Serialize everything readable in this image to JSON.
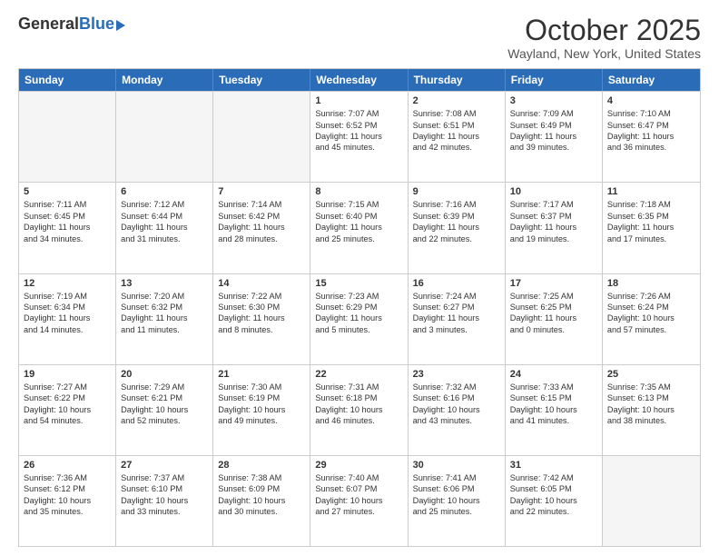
{
  "logo": {
    "general": "General",
    "blue": "Blue"
  },
  "header": {
    "month": "October 2025",
    "location": "Wayland, New York, United States"
  },
  "days_of_week": [
    "Sunday",
    "Monday",
    "Tuesday",
    "Wednesday",
    "Thursday",
    "Friday",
    "Saturday"
  ],
  "rows": [
    [
      {
        "day": "",
        "empty": true
      },
      {
        "day": "",
        "empty": true
      },
      {
        "day": "",
        "empty": true
      },
      {
        "day": "1",
        "info": "Sunrise: 7:07 AM\nSunset: 6:52 PM\nDaylight: 11 hours\nand 45 minutes."
      },
      {
        "day": "2",
        "info": "Sunrise: 7:08 AM\nSunset: 6:51 PM\nDaylight: 11 hours\nand 42 minutes."
      },
      {
        "day": "3",
        "info": "Sunrise: 7:09 AM\nSunset: 6:49 PM\nDaylight: 11 hours\nand 39 minutes."
      },
      {
        "day": "4",
        "info": "Sunrise: 7:10 AM\nSunset: 6:47 PM\nDaylight: 11 hours\nand 36 minutes."
      }
    ],
    [
      {
        "day": "5",
        "info": "Sunrise: 7:11 AM\nSunset: 6:45 PM\nDaylight: 11 hours\nand 34 minutes."
      },
      {
        "day": "6",
        "info": "Sunrise: 7:12 AM\nSunset: 6:44 PM\nDaylight: 11 hours\nand 31 minutes."
      },
      {
        "day": "7",
        "info": "Sunrise: 7:14 AM\nSunset: 6:42 PM\nDaylight: 11 hours\nand 28 minutes."
      },
      {
        "day": "8",
        "info": "Sunrise: 7:15 AM\nSunset: 6:40 PM\nDaylight: 11 hours\nand 25 minutes."
      },
      {
        "day": "9",
        "info": "Sunrise: 7:16 AM\nSunset: 6:39 PM\nDaylight: 11 hours\nand 22 minutes."
      },
      {
        "day": "10",
        "info": "Sunrise: 7:17 AM\nSunset: 6:37 PM\nDaylight: 11 hours\nand 19 minutes."
      },
      {
        "day": "11",
        "info": "Sunrise: 7:18 AM\nSunset: 6:35 PM\nDaylight: 11 hours\nand 17 minutes."
      }
    ],
    [
      {
        "day": "12",
        "info": "Sunrise: 7:19 AM\nSunset: 6:34 PM\nDaylight: 11 hours\nand 14 minutes."
      },
      {
        "day": "13",
        "info": "Sunrise: 7:20 AM\nSunset: 6:32 PM\nDaylight: 11 hours\nand 11 minutes."
      },
      {
        "day": "14",
        "info": "Sunrise: 7:22 AM\nSunset: 6:30 PM\nDaylight: 11 hours\nand 8 minutes."
      },
      {
        "day": "15",
        "info": "Sunrise: 7:23 AM\nSunset: 6:29 PM\nDaylight: 11 hours\nand 5 minutes."
      },
      {
        "day": "16",
        "info": "Sunrise: 7:24 AM\nSunset: 6:27 PM\nDaylight: 11 hours\nand 3 minutes."
      },
      {
        "day": "17",
        "info": "Sunrise: 7:25 AM\nSunset: 6:25 PM\nDaylight: 11 hours\nand 0 minutes."
      },
      {
        "day": "18",
        "info": "Sunrise: 7:26 AM\nSunset: 6:24 PM\nDaylight: 10 hours\nand 57 minutes."
      }
    ],
    [
      {
        "day": "19",
        "info": "Sunrise: 7:27 AM\nSunset: 6:22 PM\nDaylight: 10 hours\nand 54 minutes."
      },
      {
        "day": "20",
        "info": "Sunrise: 7:29 AM\nSunset: 6:21 PM\nDaylight: 10 hours\nand 52 minutes."
      },
      {
        "day": "21",
        "info": "Sunrise: 7:30 AM\nSunset: 6:19 PM\nDaylight: 10 hours\nand 49 minutes."
      },
      {
        "day": "22",
        "info": "Sunrise: 7:31 AM\nSunset: 6:18 PM\nDaylight: 10 hours\nand 46 minutes."
      },
      {
        "day": "23",
        "info": "Sunrise: 7:32 AM\nSunset: 6:16 PM\nDaylight: 10 hours\nand 43 minutes."
      },
      {
        "day": "24",
        "info": "Sunrise: 7:33 AM\nSunset: 6:15 PM\nDaylight: 10 hours\nand 41 minutes."
      },
      {
        "day": "25",
        "info": "Sunrise: 7:35 AM\nSunset: 6:13 PM\nDaylight: 10 hours\nand 38 minutes."
      }
    ],
    [
      {
        "day": "26",
        "info": "Sunrise: 7:36 AM\nSunset: 6:12 PM\nDaylight: 10 hours\nand 35 minutes."
      },
      {
        "day": "27",
        "info": "Sunrise: 7:37 AM\nSunset: 6:10 PM\nDaylight: 10 hours\nand 33 minutes."
      },
      {
        "day": "28",
        "info": "Sunrise: 7:38 AM\nSunset: 6:09 PM\nDaylight: 10 hours\nand 30 minutes."
      },
      {
        "day": "29",
        "info": "Sunrise: 7:40 AM\nSunset: 6:07 PM\nDaylight: 10 hours\nand 27 minutes."
      },
      {
        "day": "30",
        "info": "Sunrise: 7:41 AM\nSunset: 6:06 PM\nDaylight: 10 hours\nand 25 minutes."
      },
      {
        "day": "31",
        "info": "Sunrise: 7:42 AM\nSunset: 6:05 PM\nDaylight: 10 hours\nand 22 minutes."
      },
      {
        "day": "",
        "empty": true
      }
    ]
  ]
}
